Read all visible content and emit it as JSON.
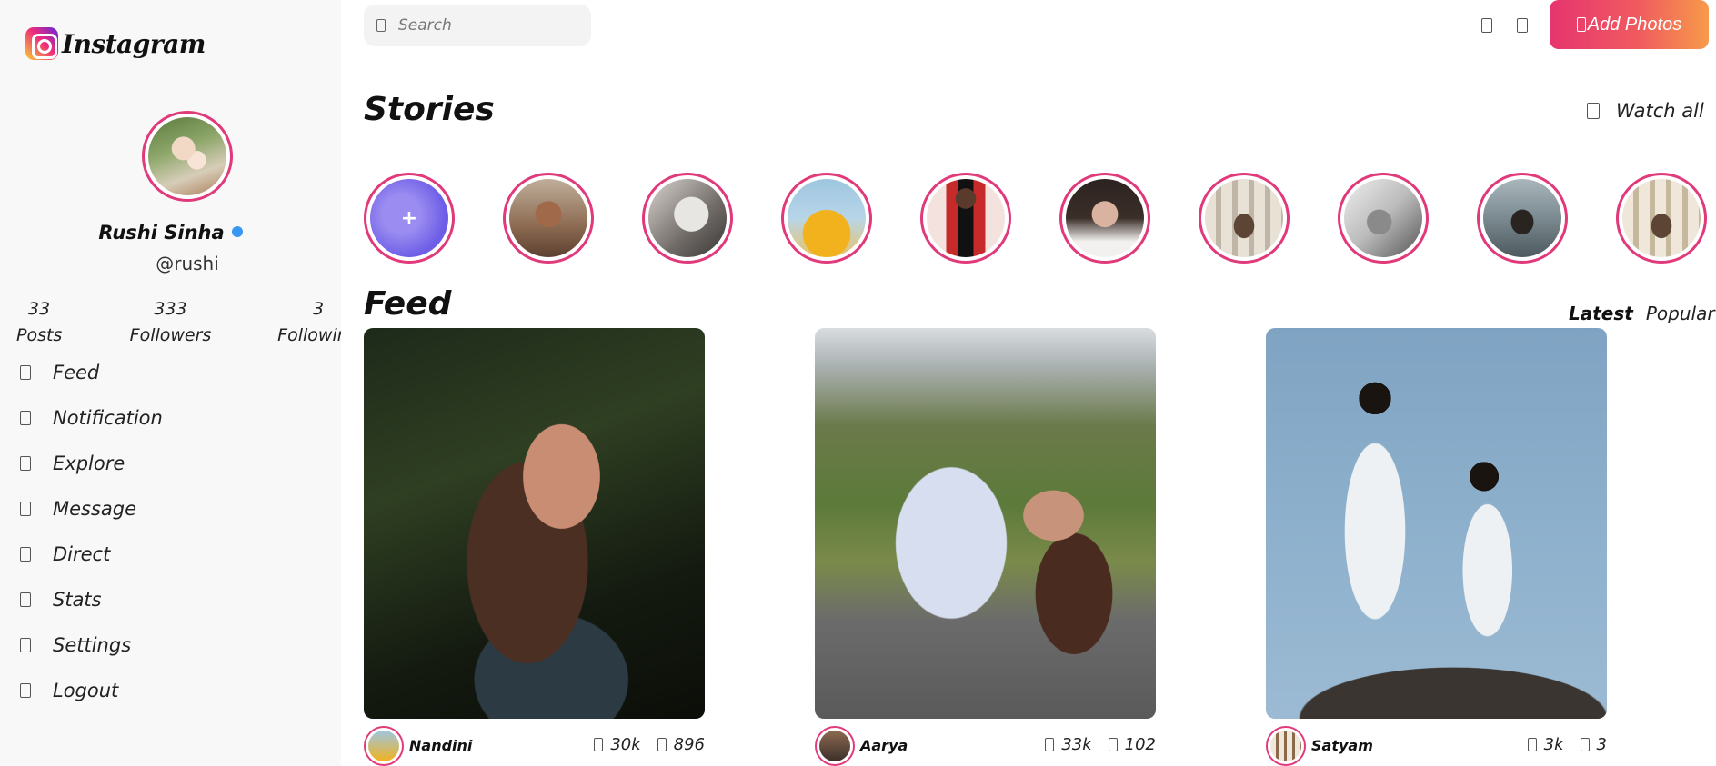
{
  "brand": {
    "name": "Instagram",
    "gradient": [
      "#f9ce34",
      "#ee2a7b",
      "#6228d7"
    ],
    "accent": "#e03a7a"
  },
  "profile": {
    "name": "Rushi Sinha",
    "handle": "@rushi",
    "verified_color": "#3897f0",
    "stats": [
      {
        "value": "33",
        "label": "Posts"
      },
      {
        "value": "333",
        "label": "Followers"
      },
      {
        "value": "3",
        "label": "Following"
      }
    ]
  },
  "nav": {
    "items": [
      {
        "label": "Feed",
        "icon": "feed-icon"
      },
      {
        "label": "Notification",
        "icon": "notification-icon"
      },
      {
        "label": "Explore",
        "icon": "explore-icon"
      },
      {
        "label": "Message",
        "icon": "message-icon"
      },
      {
        "label": "Direct",
        "icon": "direct-icon"
      },
      {
        "label": "Stats",
        "icon": "stats-icon"
      },
      {
        "label": "Settings",
        "icon": "settings-icon"
      },
      {
        "label": "Logout",
        "icon": "logout-icon"
      }
    ]
  },
  "header": {
    "search_placeholder": "Search",
    "add_photos_label": "Add Photos"
  },
  "stories": {
    "title": "Stories",
    "watch_all_label": "Watch all",
    "add_symbol": "+"
  },
  "feed": {
    "title": "Feed",
    "tabs": [
      {
        "label": "Latest",
        "active": true
      },
      {
        "label": "Popular",
        "active": false
      }
    ],
    "posts": [
      {
        "user": "Nandini",
        "likes": "30k",
        "comments": "896"
      },
      {
        "user": "Aarya",
        "likes": "33k",
        "comments": "102"
      },
      {
        "user": "Satyam",
        "likes": "3k",
        "comments": "3"
      }
    ]
  }
}
